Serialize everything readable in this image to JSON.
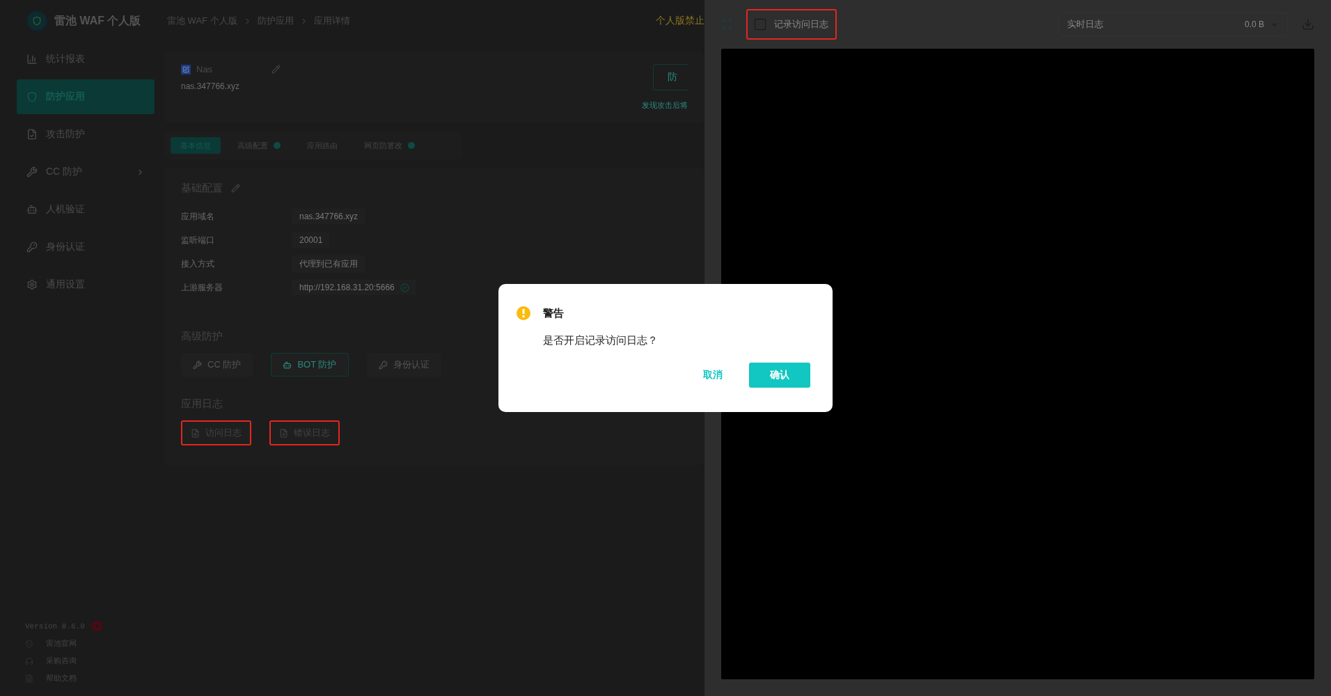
{
  "brand": {
    "name": "雷池 WAF 个人版"
  },
  "breadcrumb": [
    "雷池 WAF 个人版",
    "防护应用",
    "应用详情"
  ],
  "header_notice": "个人版禁止",
  "sidebar": {
    "items": [
      {
        "label": "统计报表",
        "selected": false,
        "expandable": false
      },
      {
        "label": "防护应用",
        "selected": true,
        "expandable": false
      },
      {
        "label": "攻击防护",
        "selected": false,
        "expandable": false
      },
      {
        "label": "CC 防护",
        "selected": false,
        "expandable": true
      },
      {
        "label": "人机验证",
        "selected": false,
        "expandable": false
      },
      {
        "label": "身份认证",
        "selected": false,
        "expandable": false
      },
      {
        "label": "通用设置",
        "selected": false,
        "expandable": false
      }
    ],
    "version": "Version 8.6.0",
    "update_available": true,
    "links": [
      "雷池官网",
      "采购咨询",
      "帮助文档"
    ]
  },
  "app_card": {
    "name": "Nas",
    "domain": "nas.347766.xyz",
    "action_button": "防",
    "hint": "发现攻击后将"
  },
  "tabs": [
    {
      "label": "基本信息",
      "selected": true,
      "badge": false
    },
    {
      "label": "高级配置",
      "selected": false,
      "badge": true
    },
    {
      "label": "应用路由",
      "selected": false,
      "badge": false
    },
    {
      "label": "网页防篡改",
      "selected": false,
      "badge": true
    }
  ],
  "basic_config": {
    "title": "基础配置",
    "rows": [
      {
        "label": "应用域名",
        "value": "nas.347766.xyz",
        "verified": false
      },
      {
        "label": "监听端口",
        "value": "20001",
        "verified": false
      },
      {
        "label": "接入方式",
        "value": "代理到已有应用",
        "verified": false
      },
      {
        "label": "上游服务器",
        "value": "http://192.168.31.20:5666",
        "verified": true
      }
    ]
  },
  "advanced": {
    "title": "高级防护",
    "buttons": [
      {
        "label": "CC 防护",
        "selected": false
      },
      {
        "label": "BOT 防护",
        "selected": true
      },
      {
        "label": "身份认证",
        "selected": false
      }
    ]
  },
  "logs": {
    "title": "应用日志",
    "buttons": [
      {
        "label": "访问日志",
        "highlighted": true
      },
      {
        "label": "错误日志",
        "highlighted": true
      }
    ]
  },
  "drawer": {
    "record_checkbox": {
      "label": "记录访问日志",
      "checked": false,
      "highlighted": true
    },
    "log_select": {
      "value": "实时日志",
      "size": "0.0 B"
    }
  },
  "dialog": {
    "title": "警告",
    "message": "是否开启记录访问日志？",
    "buttons": [
      {
        "label": "取消",
        "kind": "text"
      },
      {
        "label": "确认",
        "kind": "primary"
      }
    ]
  }
}
